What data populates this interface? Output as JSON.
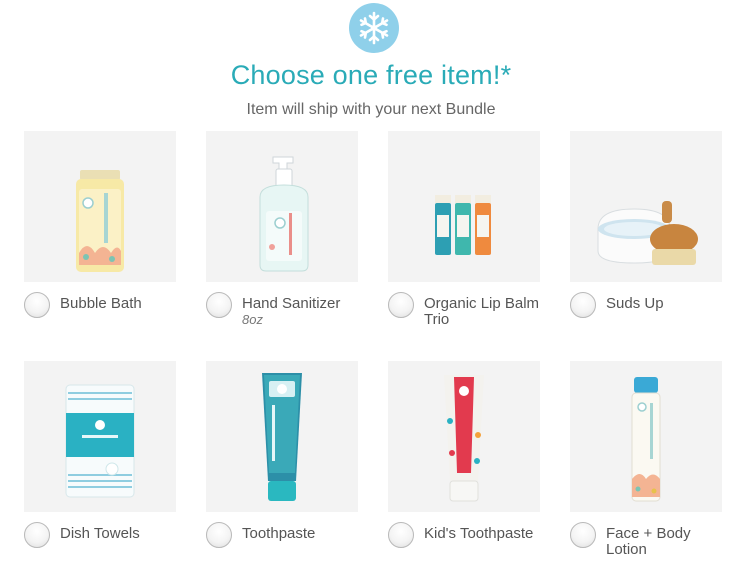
{
  "header": {
    "badge_icon": "snowflake-icon",
    "title": "Choose one free item!*",
    "subtitle": "Item will ship with your next Bundle"
  },
  "colors": {
    "accent": "#2aabb7",
    "badge": "#8fd0ea",
    "tile": "#f3f3f3"
  },
  "items": [
    {
      "name": "Bubble Bath",
      "size": ""
    },
    {
      "name": "Hand Sanitizer",
      "size": "8oz"
    },
    {
      "name": "Organic Lip Balm Trio",
      "size": ""
    },
    {
      "name": "Suds Up",
      "size": ""
    },
    {
      "name": "Dish Towels",
      "size": ""
    },
    {
      "name": "Toothpaste",
      "size": ""
    },
    {
      "name": "Kid's Toothpaste",
      "size": ""
    },
    {
      "name": "Face + Body Lotion",
      "size": ""
    }
  ]
}
